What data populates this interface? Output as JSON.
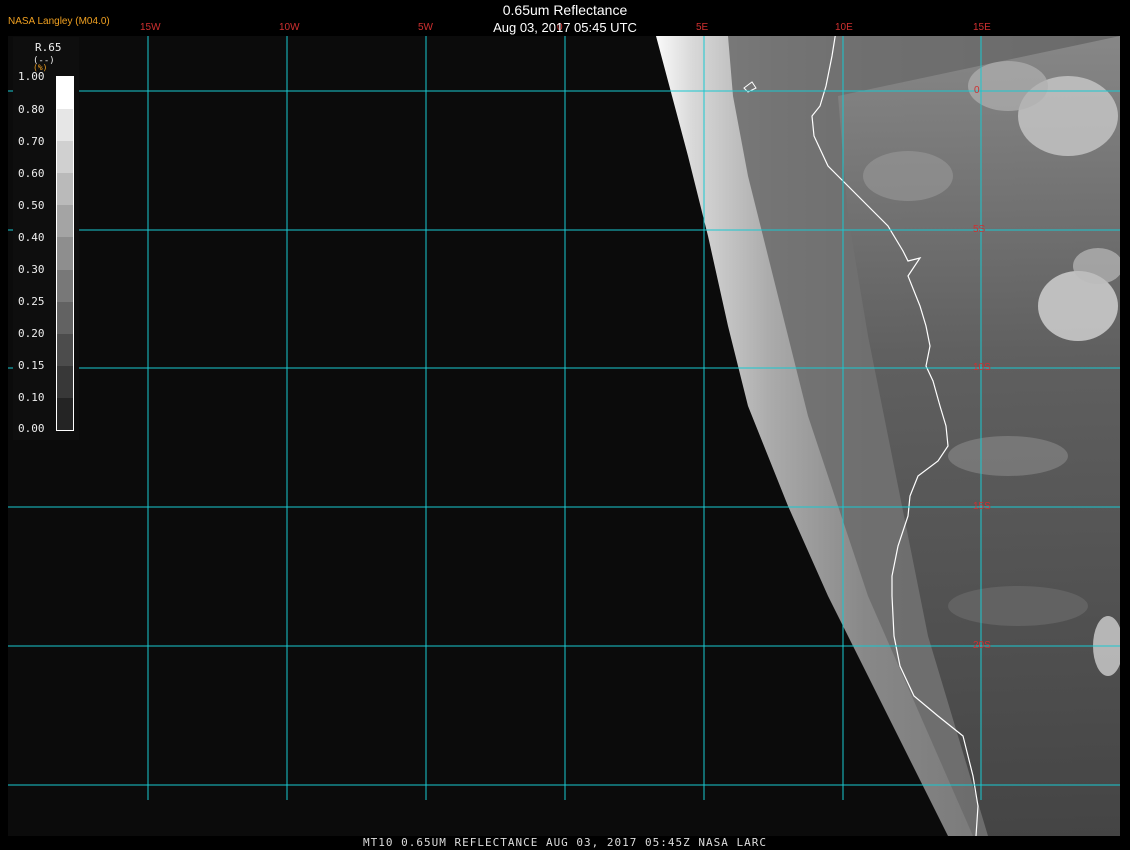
{
  "header": {
    "title": "0.65um Reflectance",
    "subtitle": "Aug 03, 2017 05:45 UTC",
    "provider": "NASA Langley (M04.0)"
  },
  "footer": {
    "text": "MT10  0.65UM REFLECTANCE   AUG 03, 2017 05:45Z   NASA LARC"
  },
  "legend": {
    "title": "R.65",
    "unit": "(--)",
    "unit2": "(%)",
    "ticks": [
      "1.00",
      "0.80",
      "0.70",
      "0.60",
      "0.50",
      "0.40",
      "0.30",
      "0.25",
      "0.20",
      "0.15",
      "0.10",
      "0.00"
    ]
  },
  "grid": {
    "lon_labels": [
      "15W",
      "10W",
      "5W",
      "0",
      "5E",
      "10E",
      "15E"
    ],
    "lat_labels": [
      "0",
      "5S",
      "10S",
      "15S",
      "20S"
    ]
  },
  "colors": {
    "gridline": "#19c8d0",
    "label": "#d03030",
    "provider": "#f0a020",
    "coast": "#ffffff"
  }
}
